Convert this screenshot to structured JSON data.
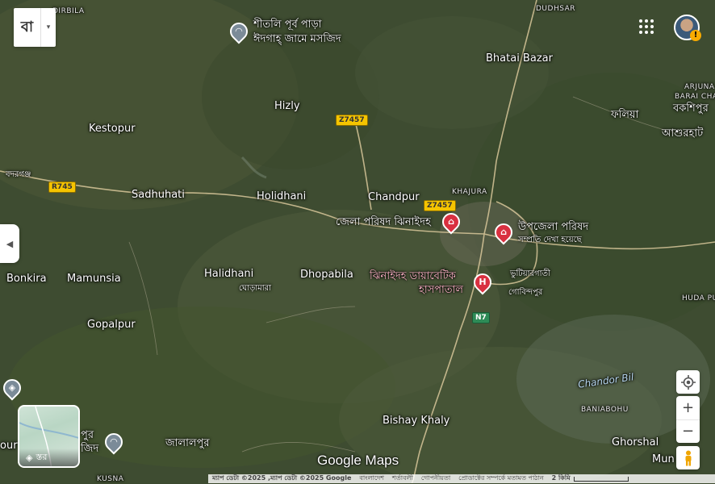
{
  "ui": {
    "lang_button": "বা",
    "lang_caret": "▾",
    "collapse": "◀",
    "warning": "!",
    "zoom_in": "+",
    "zoom_out": "−",
    "layers_label": "স্তর",
    "logo": "Google Maps",
    "footer": {
      "attribution": "ম্যাপ ডেটা ©2025 ,ম্যাপ ডেটা ©2025 Google",
      "country": "বাংলাদেশ",
      "terms": "শর্তাবলী",
      "privacy": "গোপনীয়তা",
      "feedback": "প্রোডাক্টের সম্পর্কে মতামত পাঠান",
      "scale": "2 কিমি"
    }
  },
  "labels": {
    "dirbila": "DIRBILA",
    "dudhsar": "DUDHSAR",
    "shitoli": "শীতলি পূর্ব পাড়া",
    "eidgah": "ঈদগাহ্ জামে মসজিদ",
    "bhatai": "Bhatai Bazar",
    "arjuna": "ARJUNA",
    "barai": "BARAI CHA",
    "hizly": "Hizly",
    "kestopur": "Kestopur",
    "falia": "ফলিয়া",
    "bokshipur": "বকশিপুর",
    "ashurhat": "আশুরহাট",
    "bodorgonj": "বদরগঞ্জ",
    "sadhuhati": "Sadhuhati",
    "holidhani": "Holidhani",
    "chandpur": "Chandpur",
    "khajura": "KHAJURA",
    "zilaparishad": "জেলা পরিষদ ঝিনাইদহ",
    "upazila": "উপজেলা পরিষদ",
    "upazila_sub": "সম্প্রতি দেখা হয়েছে",
    "bonkira": "Bonkira",
    "mamunsia": "Mamunsia",
    "halidhani": "Halidhani",
    "ghoramara": "ঘোড়ামারা",
    "dhopabila": "Dhopabila",
    "diabetic1": "ঝিনাইদহ ডায়াবেটিক",
    "diabetic2": "হাসপাতাল",
    "vutiarghati": "ভুটিয়ারগাতী",
    "gobindapur": "গোবিন্দপুর",
    "hudapu": "HUDA PU",
    "gopalpur": "Gopalpur",
    "chandor": "Chandor Bil",
    "baniabohu": "BANIABOHU",
    "bishay": "Bishay Khaly",
    "jalalpur": "জালালপুর",
    "pur": "পুর",
    "jid": "জিদ",
    "ghorshal": "Ghorshal",
    "mun": "Mun",
    "kusna": "KUSNA",
    "our": "our"
  },
  "shields": {
    "r745": "R745",
    "z7457a": "Z7457",
    "z7457b": "Z7457",
    "n7": "N7"
  },
  "pins": {
    "hospital": "H",
    "gov": "⌂",
    "mosque": "◠",
    "school": "◈"
  }
}
